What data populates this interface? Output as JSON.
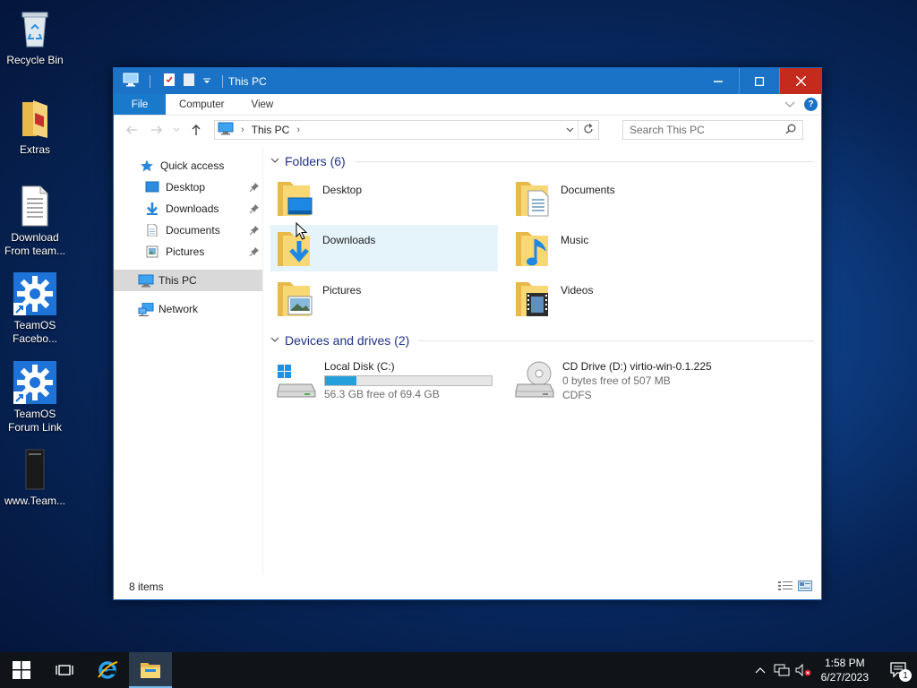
{
  "desktop": {
    "icons": [
      {
        "label": "Recycle Bin",
        "icon": "recycle-bin-icon"
      },
      {
        "label": "Extras",
        "icon": "folder-icon"
      },
      {
        "label": "Download From team...",
        "line1": "Download",
        "line2": "From team...",
        "icon": "text-file-icon"
      },
      {
        "label": "TeamOS Facebo...",
        "line1": "TeamOS",
        "line2": "Facebo...",
        "icon": "gear-shortcut-icon"
      },
      {
        "label": "TeamOS Forum Link",
        "line1": "TeamOS",
        "line2": "Forum Link",
        "icon": "gear-shortcut-icon"
      },
      {
        "label": "www.Team...",
        "icon": "file-icon"
      }
    ]
  },
  "window": {
    "title": "This PC",
    "ribbon_tabs": [
      "File",
      "Computer",
      "View"
    ],
    "help": "?",
    "address": {
      "crumb": "This PC"
    },
    "search": {
      "placeholder": "Search This PC"
    },
    "nav_pane": {
      "quick_access": "Quick access",
      "pinned": [
        {
          "label": "Desktop"
        },
        {
          "label": "Downloads"
        },
        {
          "label": "Documents"
        },
        {
          "label": "Pictures"
        }
      ],
      "this_pc": "This PC",
      "network": "Network"
    },
    "folders": {
      "header": "Folders (6)",
      "items": [
        {
          "name": "Desktop"
        },
        {
          "name": "Documents"
        },
        {
          "name": "Downloads"
        },
        {
          "name": "Music"
        },
        {
          "name": "Pictures"
        },
        {
          "name": "Videos"
        }
      ]
    },
    "drives": {
      "header": "Devices and drives (2)",
      "items": [
        {
          "name": "Local Disk (C:)",
          "free_text": "56.3 GB free of 69.4 GB",
          "used_fraction": 0.189
        },
        {
          "name": "CD Drive (D:) virtio-win-0.1.225",
          "free_text": "0 bytes free of 507 MB",
          "fs": "CDFS"
        }
      ]
    },
    "status": "8 items"
  },
  "taskbar": {
    "time": "1:58 PM",
    "date": "6/27/2023",
    "notification_count": "1"
  },
  "colors": {
    "titlebar": "#1a73c7",
    "close": "#c42b1c",
    "selection": "#d9d9d9",
    "hover": "#e5f3fb",
    "bar_fill": "#26a0da",
    "group_header": "#1e3287"
  }
}
